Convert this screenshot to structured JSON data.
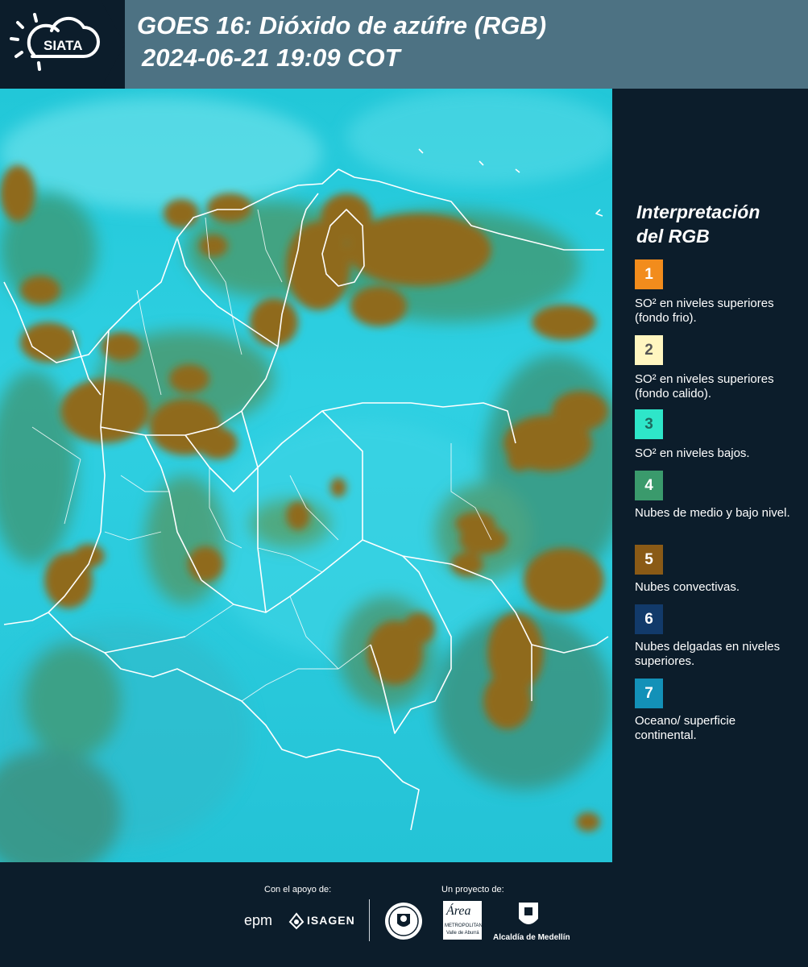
{
  "header": {
    "logo_text": "SIATA",
    "title_line1": "GOES 16: Dióxido de azúfre (RGB)",
    "title_line2": "2024-06-21 19:09 COT"
  },
  "legend": {
    "title_line1": "Interpretación",
    "title_line2": "del RGB",
    "items": [
      {
        "number": "1",
        "color": "#f28c1c",
        "label": "SO² en niveles superiores (fondo frio)."
      },
      {
        "number": "2",
        "color": "#fff6c0",
        "label": "SO² en niveles superiores (fondo calido)."
      },
      {
        "number": "3",
        "color": "#2ee6c9",
        "label": "SO² en niveles bajos."
      },
      {
        "number": "4",
        "color": "#3a9a6c",
        "label": "Nubes de medio y bajo nivel."
      },
      {
        "number": "5",
        "color": "#8a5a16",
        "label": "Nubes convectivas."
      },
      {
        "number": "6",
        "color": "#123a6a",
        "label": "Nubes delgadas en niveles superiores."
      },
      {
        "number": "7",
        "color": "#1391b8",
        "label": "Oceano/ superficie continental."
      }
    ]
  },
  "footer": {
    "support_label": "Con el apoyo de:",
    "project_label": "Un proyecto de:",
    "epm_text": "epm",
    "isagen_text": "ISAGEN",
    "area_text": "Área",
    "area_sub1": "METROPOLITANA",
    "area_sub2": "Valle de Aburrá",
    "alcaldia_text": "Alcaldía de Medellín"
  }
}
